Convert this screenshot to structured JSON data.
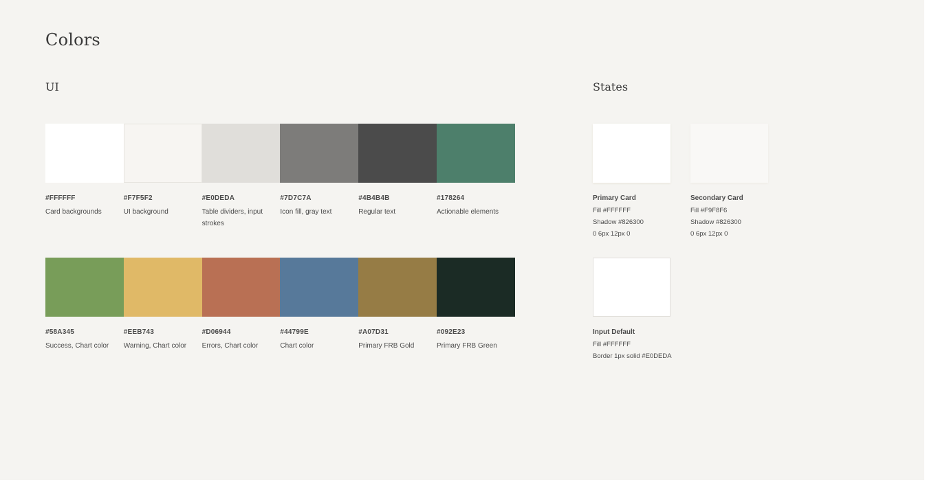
{
  "page": {
    "title": "Colors"
  },
  "ui_section": {
    "title": "UI",
    "row1": [
      {
        "hex": "#FFFFFF",
        "color": "#FFFFFF",
        "desc": "Card backgrounds"
      },
      {
        "hex": "#F7F5F2",
        "color": "#F7F5F2",
        "desc": "UI background"
      },
      {
        "hex": "#E0DEDA",
        "color": "#E0DEDA",
        "desc": "Table dividers, input strokes"
      },
      {
        "hex": "#7D7C7A",
        "color": "#7D7C7A",
        "desc": "Icon fill, gray text"
      },
      {
        "hex": "#4B4B4B",
        "color": "#4B4B4B",
        "desc": "Regular text"
      },
      {
        "hex": "#178264",
        "color": "#4D7F6B",
        "desc": "Actionable elements"
      }
    ],
    "row2": [
      {
        "hex": "#58A345",
        "color": "#789D59",
        "desc": "Success, Chart color"
      },
      {
        "hex": "#EEB743",
        "color": "#E0B967",
        "desc": "Warning, Chart color"
      },
      {
        "hex": "#D06944",
        "color": "#B97054",
        "desc": "Errors, Chart color"
      },
      {
        "hex": "#44799E",
        "color": "#57799A",
        "desc": "Chart color"
      },
      {
        "hex": "#A07D31",
        "color": "#967C45",
        "desc": "Primary FRB Gold"
      },
      {
        "hex": "#092E23",
        "color": "#1B2B25",
        "desc": "Primary FRB Green"
      }
    ]
  },
  "states_section": {
    "title": "States",
    "items": [
      {
        "name": "Primary Card",
        "lines": [
          "Fill #FFFFFF",
          "Shadow #826300",
          "0 6px 12px 0"
        ],
        "fill": "#FFFFFF",
        "border": "none",
        "shadow": "0 1px 3px rgba(130,99,0,0.10)"
      },
      {
        "name": "Secondary Card",
        "lines": [
          "Fill #F9F8F6",
          "Shadow #826300",
          "0 6px 12px 0"
        ],
        "fill": "#F9F8F6",
        "border": "none",
        "shadow": "0 1px 3px rgba(130,99,0,0.06)"
      },
      {
        "name": "Input Default",
        "lines": [
          "Fill #FFFFFF",
          "Border 1px solid #E0DEDA"
        ],
        "fill": "#FFFFFF",
        "border": "1px solid #E0DEDA",
        "shadow": "none"
      }
    ]
  }
}
